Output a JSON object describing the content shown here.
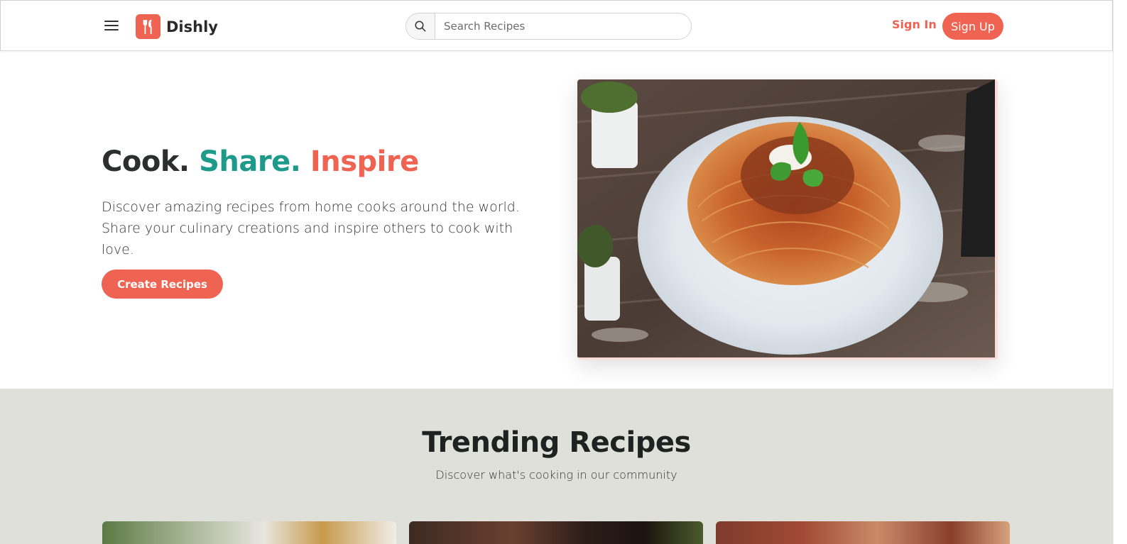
{
  "header": {
    "brand": "Dishly",
    "search_placeholder": "Search Recipes",
    "signin_label": "Sign In",
    "signup_label": "Sign Up",
    "icons": [
      "menu-icon",
      "fork-knife-icon",
      "search-icon"
    ]
  },
  "hero": {
    "title_word1": "Cook.",
    "title_word2": "Share.",
    "title_word3": "Inspire",
    "description": "Discover amazing recipes from home cooks around the world. Share your culinary creations and inspire others to cook with love.",
    "cta_label": "Create Recipes"
  },
  "trending": {
    "title": "Trending Recipes",
    "subtitle": "Discover what's cooking in our community"
  },
  "colors": {
    "accent": "#ee6352",
    "teal": "#1e9a8b",
    "section_bg": "#e0e0da"
  }
}
